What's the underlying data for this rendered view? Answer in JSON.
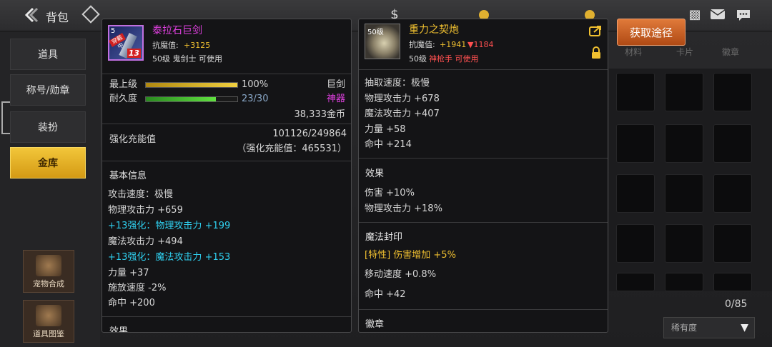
{
  "topbar": {
    "back_icon": "arrow-left-icon",
    "title": "背包"
  },
  "left_menu": {
    "items": [
      {
        "label": "道具"
      },
      {
        "label": "称号/勋章"
      },
      {
        "label": "装扮"
      },
      {
        "label": "金库"
      }
    ],
    "side_buttons": [
      {
        "label": "宠物合成"
      },
      {
        "label": "道具图鉴"
      }
    ]
  },
  "item1": {
    "icon": "greatsword-icon",
    "icon_level": "5",
    "icon_tag": "穿戴中",
    "icon_plus": "13",
    "name": "泰拉石巨剑",
    "resist_label": "抗魔值:",
    "resist_value": "+3125",
    "requirement": "50级 鬼剑士 可使用",
    "grade_label": "最上级",
    "grade_percent": "100%",
    "grade_fill": 1.0,
    "type": "巨剑",
    "durability_label": "耐久度",
    "durability_value": "23/30",
    "durability_fill": 0.767,
    "rarity": "神器",
    "price": "38,333金币",
    "charge_label": "强化充能值",
    "charge_value": "101126/249864",
    "charge_sub": "（强化充能值：465531）",
    "basic_info_title": "基本信息",
    "stats": [
      {
        "text": "攻击速度：极慢",
        "color": "white"
      },
      {
        "text": "物理攻击力 +659",
        "color": "white"
      },
      {
        "text": "+13强化：物理攻击力 +199",
        "color": "cyan"
      },
      {
        "text": "魔法攻击力 +494",
        "color": "white"
      },
      {
        "text": "+13强化：魔法攻击力 +153",
        "color": "cyan"
      },
      {
        "text": "力量 +37",
        "color": "white"
      },
      {
        "text": "施放速度 -2%",
        "color": "white"
      },
      {
        "text": "命中 +200",
        "color": "white"
      }
    ],
    "cut_section": "效果"
  },
  "item2": {
    "icon": "cannon-icon",
    "icon_level": "50级",
    "name": "重力之契炮",
    "resist_label": "抗魔值:",
    "resist_value": "+1941",
    "resist_diff": "▼1184",
    "requirement_level": "50级",
    "requirement_class": "神枪手 可使用",
    "stats": [
      "抽取速度：极慢",
      "物理攻击力 +678",
      "魔法攻击力 +407",
      "力量 +58",
      "命中 +214"
    ],
    "effect_title": "效果",
    "effects": [
      "伤害 +10%",
      "物理攻击力 +18%"
    ],
    "seal_title": "魔法封印",
    "seal_stats": [
      {
        "text": "[特性] 伤害增加 +5%",
        "color": "gold"
      },
      {
        "text": "移动速度 +0.8%",
        "color": "white"
      },
      {
        "text": "命中 +42",
        "color": "white"
      }
    ],
    "badge_title": "徽章"
  },
  "right": {
    "obtain_button": "获取途径",
    "tabs": [
      "材料",
      "卡片",
      "徽章"
    ],
    "count": "0/85",
    "sort_label": "稀有度",
    "sort_arrow": "▼"
  },
  "colors": {
    "accent_gold": "#f0c030",
    "enhance_cyan": "#2fd0f0",
    "rarity_magenta": "#e040e0",
    "down_red": "#ff5050",
    "obtain_orange": "#c8602a"
  }
}
